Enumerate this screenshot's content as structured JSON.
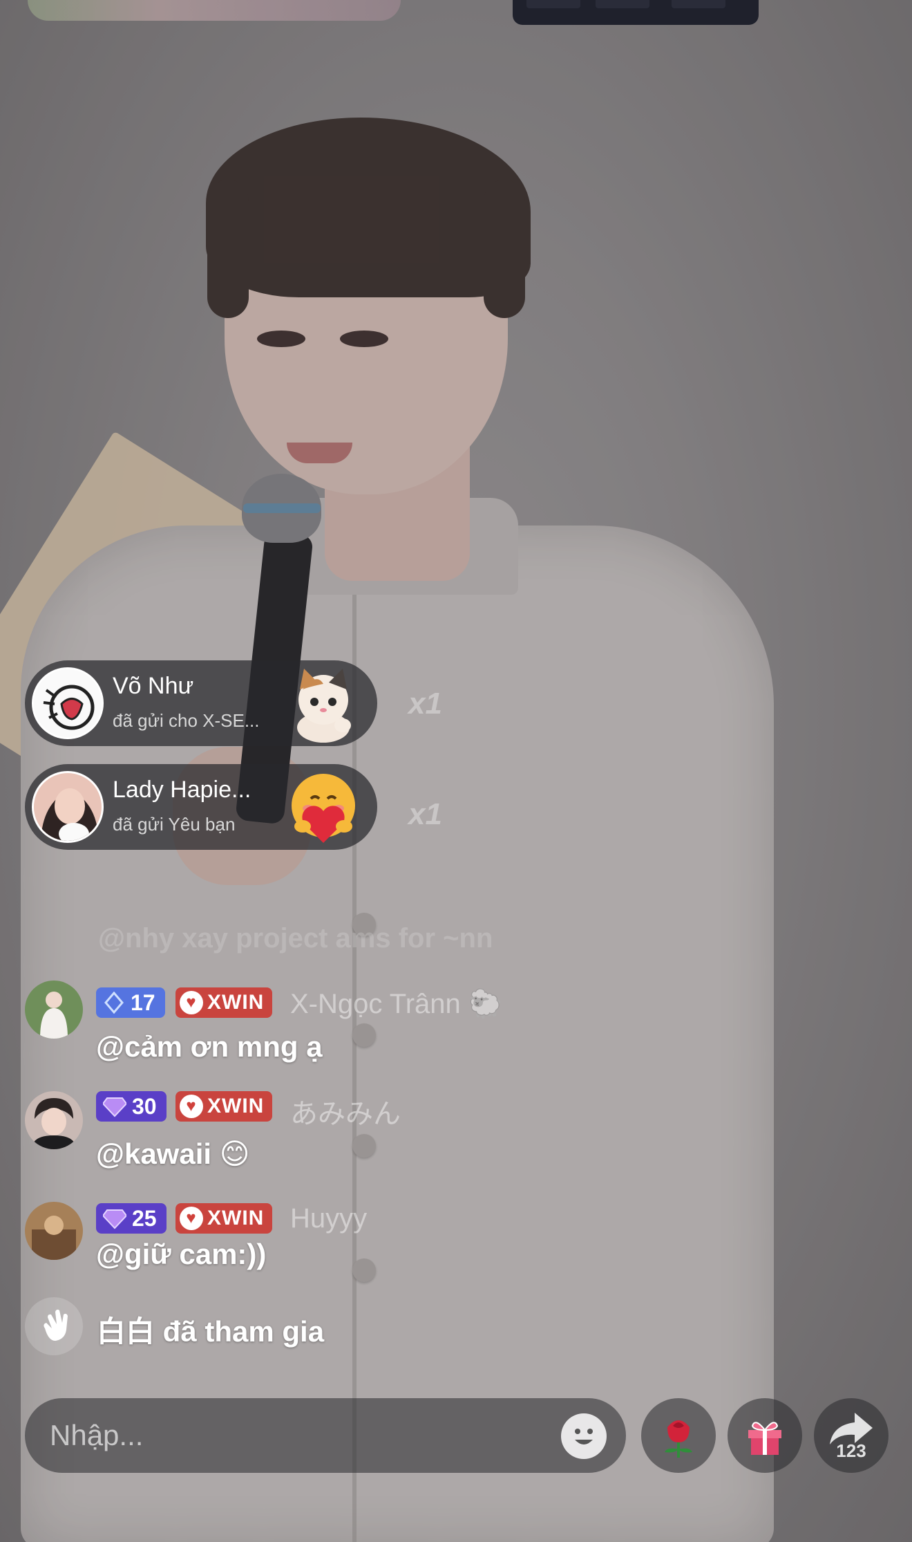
{
  "gift_notifications": [
    {
      "name": "Võ Như",
      "subtitle": "đã gửi cho X-SE...",
      "gift_icon": "cat-icon",
      "count": "x1"
    },
    {
      "name": "Lady Hapie...",
      "subtitle": "đã gửi Yêu bạn",
      "gift_icon": "hug-heart-icon",
      "count": "x1"
    }
  ],
  "chat": {
    "faded_line": "@nhy xay project ams for ~nn",
    "messages": [
      {
        "level": "17",
        "badge": "XWIN",
        "username": "X-Ngọc Trânn 🐑",
        "text": "@cảm ơn mng ạ",
        "emoji": ""
      },
      {
        "level": "30",
        "badge": "XWIN",
        "username": "あみみん",
        "text": "@kawaii",
        "emoji": "😊"
      },
      {
        "level": "25",
        "badge": "XWIN",
        "username": "Huyyy",
        "text": "@giữ cam:))",
        "emoji": ""
      }
    ],
    "joined": "白白 đã tham gia"
  },
  "bottom_bar": {
    "input_placeholder": "Nhập...",
    "share_count": "123"
  },
  "colors": {
    "level_badge": "#4a5bd6",
    "xwin_badge": "#c9443e",
    "overlay": "#28282c"
  }
}
